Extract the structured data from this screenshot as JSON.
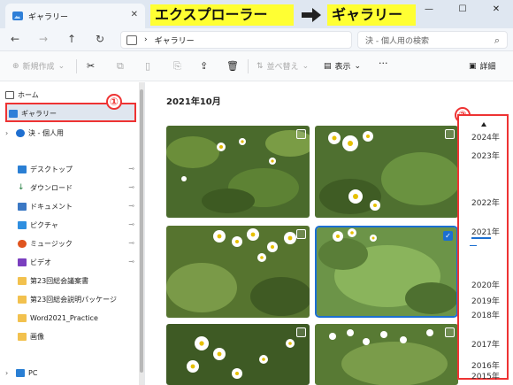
{
  "window": {
    "tab_label": "ギャラリー",
    "tab_close": "✕",
    "add_tab": "+",
    "minimize": "—",
    "maximize": "☐",
    "close": "✕"
  },
  "annotation": {
    "caption_from": "エクスプローラー",
    "caption_to": "ギャラリー",
    "marker_1": "①",
    "marker_2": "②"
  },
  "address": {
    "back": "←",
    "forward": "→",
    "up": "↑",
    "refresh": "↻",
    "path_sep": "›",
    "path_label": "ギャラリー",
    "search_placeholder": "決 - 個人用の検索",
    "search_icon": "⌕"
  },
  "toolbar": {
    "new_label": "新規作成",
    "sort_label": "並べ替え",
    "view_label": "表示",
    "more_label": "···",
    "details_label": "詳細"
  },
  "sidebar": {
    "items": [
      {
        "label": "ホーム",
        "icon": "home-icon"
      },
      {
        "label": "ギャラリー",
        "icon": "gallery-icon"
      },
      {
        "label": "決 - 個人用",
        "icon": "cloud-icon"
      },
      {
        "label": "デスクトップ",
        "icon": "desktop-icon"
      },
      {
        "label": "ダウンロード",
        "icon": "download-icon"
      },
      {
        "label": "ドキュメント",
        "icon": "document-icon"
      },
      {
        "label": "ピクチャ",
        "icon": "pictures-icon"
      },
      {
        "label": "ミュージック",
        "icon": "music-icon"
      },
      {
        "label": "ビデオ",
        "icon": "video-icon"
      },
      {
        "label": "第23回総会議案書",
        "icon": "folder-icon"
      },
      {
        "label": "第23回総会説明パッケージ",
        "icon": "folder-icon"
      },
      {
        "label": "Word2021_Practice",
        "icon": "folder-icon"
      },
      {
        "label": "画像",
        "icon": "folder-icon"
      },
      {
        "label": "PC",
        "icon": "pc-icon"
      }
    ],
    "pin": "📌",
    "expand": "›"
  },
  "gallery": {
    "date_heading": "2021年10月",
    "selected_check": "✓"
  },
  "timeline": {
    "years": [
      "2024年",
      "2023年",
      "2022年",
      "2021年",
      "2020年",
      "2019年",
      "2018年",
      "2017年",
      "2016年",
      "2015年"
    ],
    "current": "2021年"
  },
  "colors": {
    "accent": "#1c6fd1",
    "annotation_red": "#e33333",
    "caption_yellow": "#ffff33"
  }
}
